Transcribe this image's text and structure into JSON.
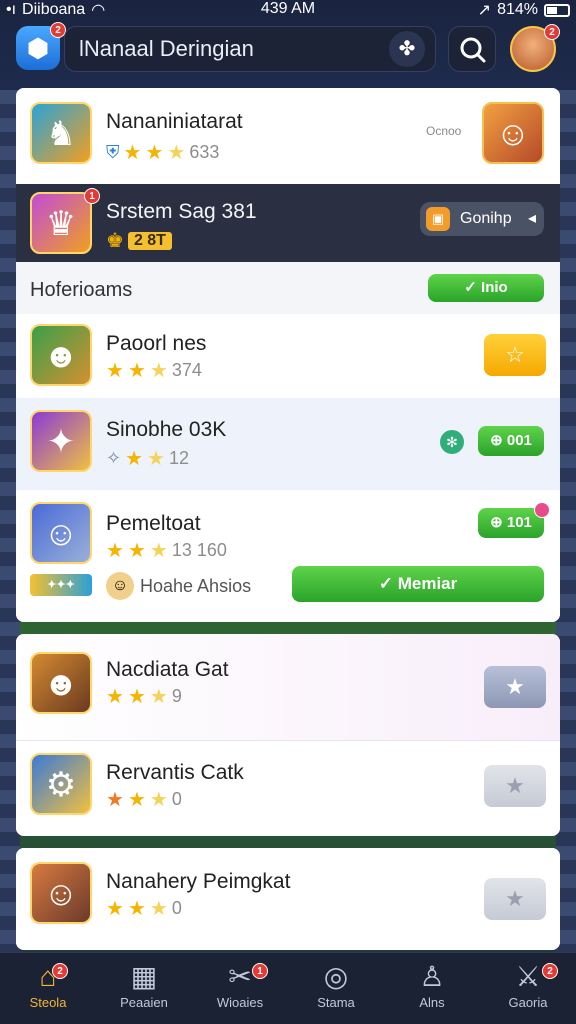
{
  "status_bar": {
    "carrier": "Diiboana",
    "time": "439 AM",
    "battery": "814%"
  },
  "header": {
    "title": "lNanaal Deringian",
    "app_badge": "2",
    "avatar_badge": "2"
  },
  "featured": [
    {
      "name": "Nananiniatarat",
      "rating": "633",
      "side_text": "Ocnoo"
    },
    {
      "name": "Srstem Sag 381",
      "gold_badge": "2 8T",
      "button_label": "Gonihp",
      "badge": "1"
    }
  ],
  "section": {
    "title": "Hoferioams",
    "button_label": "Inio"
  },
  "list_items": [
    {
      "name": "Paoorl nes",
      "rating": "374"
    },
    {
      "name": "Sinobhe 03K",
      "rating": "12",
      "action_label": "001"
    },
    {
      "name": "Pemeltoat",
      "rating": "13 160",
      "action_label": "101",
      "secondary_text": "Hoahe Ahsios",
      "cta_label": "Memiar"
    }
  ],
  "list_items_2": [
    {
      "name": "Nacdiata Gat",
      "rating": "9"
    },
    {
      "name": "Rervantis Catk",
      "rating": "0"
    },
    {
      "name": "Nanahery Peimgkat",
      "rating": "0"
    }
  ],
  "bottom_nav": [
    {
      "label": "Steola",
      "icon": "home-icon",
      "badge": "2",
      "active": true
    },
    {
      "label": "Peaaien",
      "icon": "store-icon"
    },
    {
      "label": "Wioaies",
      "icon": "tools-icon",
      "badge": "1"
    },
    {
      "label": "Stama",
      "icon": "trophy-icon"
    },
    {
      "label": "Alns",
      "icon": "user-icon"
    },
    {
      "label": "Gaoria",
      "icon": "game-icon",
      "badge": "2"
    }
  ],
  "colors": {
    "green": "#2aa32a",
    "gold": "#f5b400",
    "dark_row": "#2a3041",
    "active_nav": "#f2b53a"
  }
}
